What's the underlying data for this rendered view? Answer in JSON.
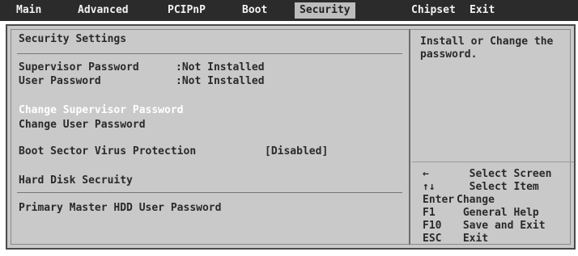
{
  "menu": {
    "items": [
      {
        "label": "Main"
      },
      {
        "label": "Advanced"
      },
      {
        "label": "PCIPnP"
      },
      {
        "label": "Boot"
      },
      {
        "label": "Security",
        "active": true
      },
      {
        "label": "Chipset"
      },
      {
        "label": "Exit"
      }
    ]
  },
  "security": {
    "section_title": "Security Settings",
    "supervisor_password_label": "Supervisor Password",
    "supervisor_password_value": ":Not Installed",
    "user_password_label": "User Password",
    "user_password_value": ":Not Installed",
    "change_supervisor_password": "Change Supervisor Password",
    "change_user_password": "Change User Password",
    "boot_sector_virus_label": "Boot Sector Virus Protection",
    "boot_sector_virus_value": "[Disabled]",
    "hard_disk_title": "Hard Disk Secruity",
    "primary_master_hdd": "Primary Master HDD User Password"
  },
  "help": {
    "text": "Install or Change the password.",
    "keys": [
      {
        "key": "←",
        "desc": "  Select Screen"
      },
      {
        "key": "↑↓",
        "desc": "  Select Item"
      },
      {
        "key": "Enter",
        "desc": "Change"
      },
      {
        "key": "F1",
        "desc": " General Help"
      },
      {
        "key": "F10",
        "desc": " Save and Exit"
      },
      {
        "key": "ESC",
        "desc": " Exit"
      }
    ]
  },
  "colors": {
    "menubar_bg": "#2b2b2b",
    "panel_bg": "#c9c9c9",
    "selected_text": "#ffffff",
    "active_tab_bg": "#bdbdbd"
  }
}
